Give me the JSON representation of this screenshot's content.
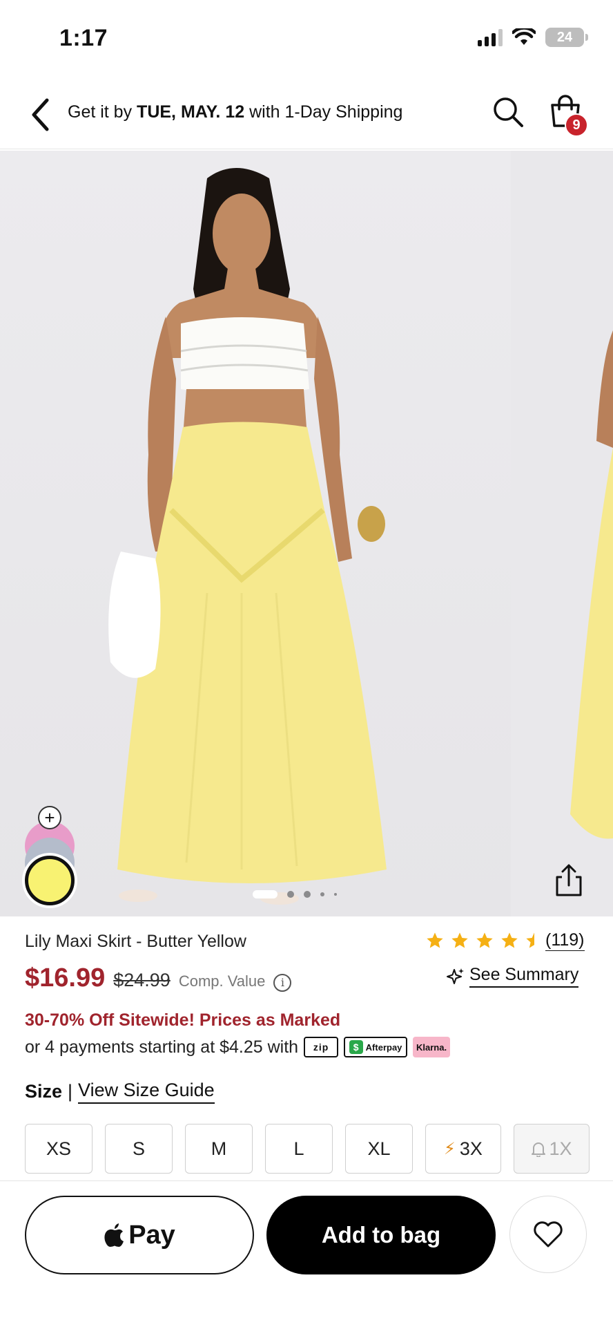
{
  "status_bar": {
    "time": "1:17",
    "battery": "24"
  },
  "header": {
    "shipping_prefix": "Get it by ",
    "shipping_date": "TUE, MAY. 12",
    "shipping_suffix": " with 1-Day Shipping",
    "bag_count": "9"
  },
  "gallery": {
    "swatches": [
      "pink",
      "blue-gray",
      "butter-yellow"
    ],
    "selected_swatch": "butter-yellow",
    "swatch_colors": {
      "pink": "#e89cc9",
      "blue": "#b4bccb",
      "yellow": "#f8f272"
    },
    "plus_label": "+"
  },
  "product": {
    "title": "Lily Maxi Skirt - Butter Yellow",
    "rating": 4.5,
    "review_count": "(119)",
    "price": "$16.99",
    "original_price": "$24.99",
    "comp_value_label": "Comp. Value",
    "see_summary": "See Summary",
    "promo": "30-70% Off Sitewide! Prices as Marked",
    "payments_text": "or 4 payments starting at $4.25 with",
    "payment_providers": {
      "zip": "zip",
      "afterpay": "Afterpay",
      "klarna": "Klarna."
    }
  },
  "sizes": {
    "label": "Size",
    "guide": "View Size Guide",
    "options": [
      "XS",
      "S",
      "M",
      "L",
      "XL",
      "3X",
      "1X"
    ]
  },
  "actions": {
    "apple_pay": "Pay",
    "add_to_bag": "Add to bag"
  },
  "colors": {
    "accent_red": "#a0242d",
    "badge_red": "#c8232c",
    "star": "#f5b014"
  }
}
